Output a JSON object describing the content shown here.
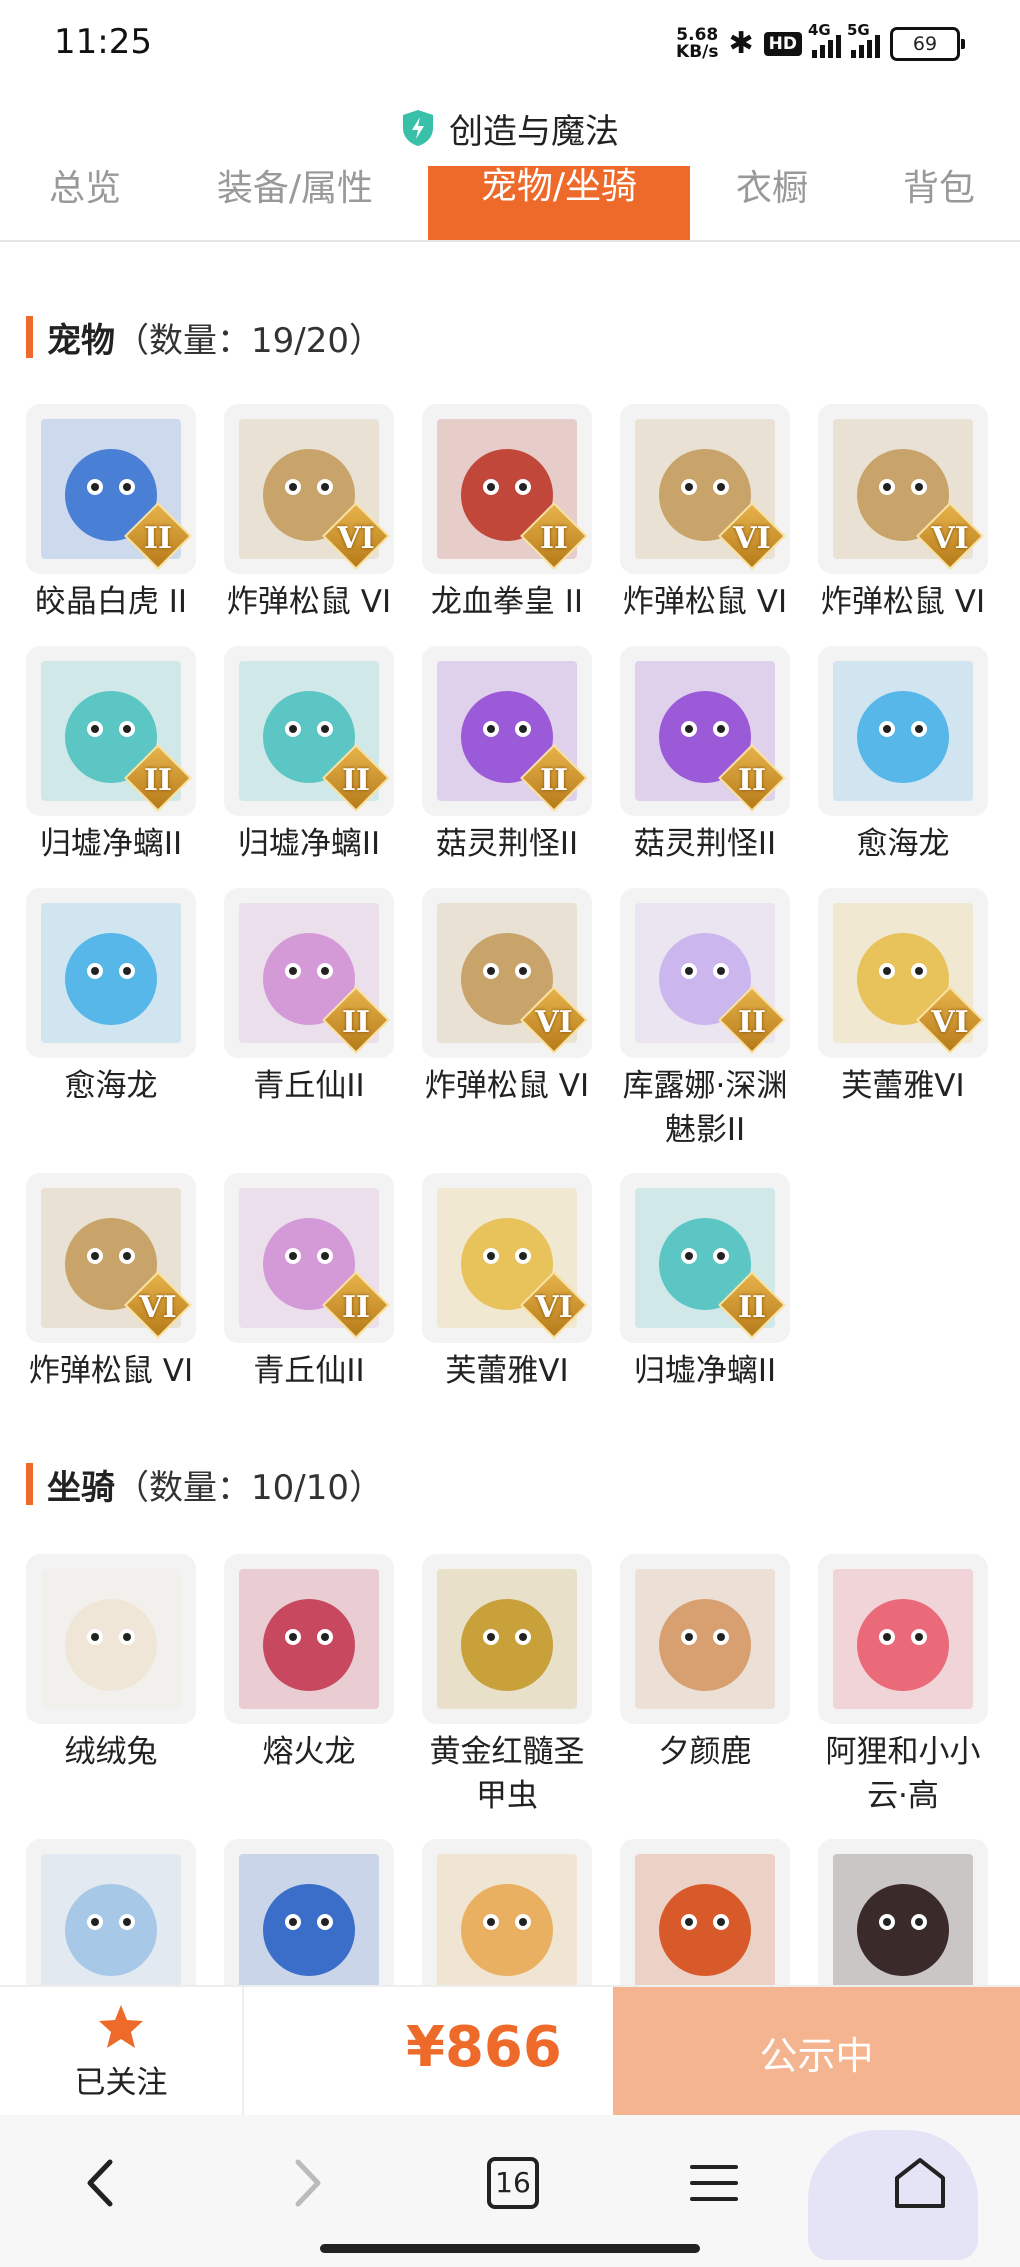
{
  "status_bar": {
    "time": "11:25",
    "speed_value": "5.68",
    "speed_unit": "KB/s",
    "hd": "HD",
    "sig1": "4G",
    "sig2": "5G",
    "battery": "69"
  },
  "header": {
    "title": "创造与魔法",
    "shield_color": "#38c0a8"
  },
  "tabs": [
    {
      "label": "总览",
      "active": false
    },
    {
      "label": "装备/属性",
      "active": false
    },
    {
      "label": "宠物/坐骑",
      "active": true
    },
    {
      "label": "衣橱",
      "active": false
    },
    {
      "label": "背包",
      "active": false
    }
  ],
  "pets": {
    "title": "宠物",
    "count": "（数量：19/20）",
    "items": [
      {
        "name": "皎晶白虎 II",
        "icon": "white-tiger-icon",
        "badge": "II",
        "color": "#4a7fd6"
      },
      {
        "name": "炸弹松鼠 VI",
        "icon": "bomb-squirrel-icon",
        "badge": "VI",
        "color": "#c9a46a"
      },
      {
        "name": "龙血拳皇 II",
        "icon": "dragon-boxer-icon",
        "badge": "II",
        "color": "#c0473a"
      },
      {
        "name": "炸弹松鼠 VI",
        "icon": "bomb-squirrel-icon",
        "badge": "VI",
        "color": "#c9a46a"
      },
      {
        "name": "炸弹松鼠 VI",
        "icon": "bomb-squirrel-icon",
        "badge": "VI",
        "color": "#c9a46a"
      },
      {
        "name": "归墟净螭II",
        "icon": "jade-dragon-icon",
        "badge": "II",
        "color": "#5cc6c4"
      },
      {
        "name": "归墟净螭II",
        "icon": "jade-dragon-icon",
        "badge": "II",
        "color": "#5cc6c4"
      },
      {
        "name": "菇灵荆怪II",
        "icon": "mushroom-imp-icon",
        "badge": "II",
        "color": "#9b5ad8"
      },
      {
        "name": "菇灵荆怪II",
        "icon": "mushroom-imp-icon",
        "badge": "II",
        "color": "#9b5ad8"
      },
      {
        "name": "愈海龙",
        "icon": "sea-dragon-icon",
        "badge": "",
        "color": "#56b7e8"
      },
      {
        "name": "愈海龙",
        "icon": "sea-dragon-icon",
        "badge": "",
        "color": "#56b7e8"
      },
      {
        "name": "青丘仙II",
        "icon": "fox-fairy-icon",
        "badge": "II",
        "color": "#d49ad8"
      },
      {
        "name": "炸弹松鼠 VI",
        "icon": "bomb-squirrel-icon",
        "badge": "VI",
        "color": "#c9a46a"
      },
      {
        "name": "库露娜·深渊魅影II",
        "icon": "kuluna-icon",
        "badge": "II",
        "color": "#cbb6ee"
      },
      {
        "name": "芙蕾雅VI",
        "icon": "freya-icon",
        "badge": "VI",
        "color": "#e8c25a"
      },
      {
        "name": "炸弹松鼠 VI",
        "icon": "bomb-squirrel-icon",
        "badge": "VI",
        "color": "#c9a46a"
      },
      {
        "name": "青丘仙II",
        "icon": "fox-fairy-icon",
        "badge": "II",
        "color": "#d49ad8"
      },
      {
        "name": "芙蕾雅VI",
        "icon": "freya-icon",
        "badge": "VI",
        "color": "#e8c25a"
      },
      {
        "name": "归墟净螭II",
        "icon": "jade-dragon-icon",
        "badge": "II",
        "color": "#5cc6c4"
      }
    ]
  },
  "mounts": {
    "title": "坐骑",
    "count": "（数量：10/10）",
    "items": [
      {
        "name": "绒绒兔",
        "icon": "fluffy-rabbit-icon",
        "color": "#f0e6d8"
      },
      {
        "name": "熔火龙",
        "icon": "lava-dragon-icon",
        "color": "#c84860"
      },
      {
        "name": "黄金红髓圣甲虫",
        "icon": "golden-scarab-icon",
        "color": "#c9a13a"
      },
      {
        "name": "夕颜鹿",
        "icon": "dusk-deer-icon",
        "color": "#d8a070"
      },
      {
        "name": "阿狸和小小云·高",
        "icon": "ali-cloud-icon",
        "color": "#ea6a7a"
      },
      {
        "name": "",
        "icon": "sheep-mount-icon",
        "color": "#a8c8e8"
      },
      {
        "name": "",
        "icon": "blue-phoenix-icon",
        "color": "#3a6ec8"
      },
      {
        "name": "",
        "icon": "golden-bird-icon",
        "color": "#e8b060"
      },
      {
        "name": "",
        "icon": "fire-dragon-icon",
        "color": "#d85a2a"
      },
      {
        "name": "",
        "icon": "black-pig-icon",
        "color": "#3a2a2a"
      }
    ]
  },
  "bottom": {
    "follow_label": "已关注",
    "price": "¥866",
    "public_label": "公示中",
    "accent": "#ee6a2b"
  },
  "browser_nav": {
    "tab_count": "16"
  }
}
